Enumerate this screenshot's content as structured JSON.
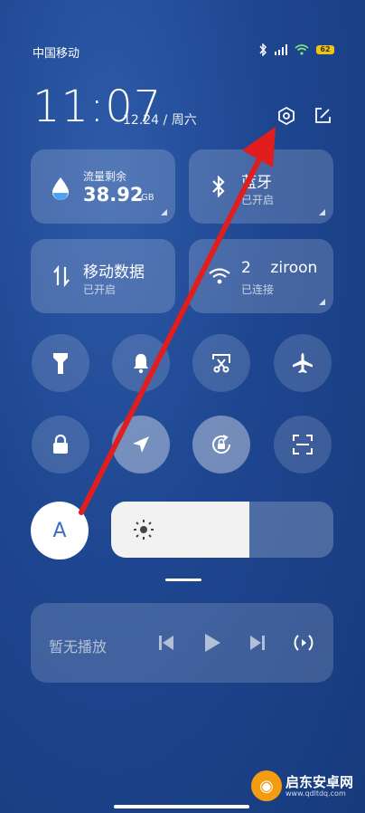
{
  "status": {
    "carrier": "中国移动",
    "battery": "62"
  },
  "header": {
    "time": "11:07",
    "date": "12.24 / 周六"
  },
  "tiles": {
    "data_left": {
      "title": "流量剩余",
      "value": "38.92",
      "unit": "GB"
    },
    "bluetooth": {
      "title": "蓝牙",
      "sub": "已开启"
    },
    "mobile_data": {
      "title": "移动数据",
      "sub": "已开启"
    },
    "wifi": {
      "title": "2    ziroon",
      "sub": "已连接"
    }
  },
  "toggles": [
    {
      "name": "flashlight-icon",
      "on": false
    },
    {
      "name": "bell-icon",
      "on": false
    },
    {
      "name": "screenshot-icon",
      "on": false
    },
    {
      "name": "airplane-icon",
      "on": false
    },
    {
      "name": "lock-icon",
      "on": false
    },
    {
      "name": "location-icon",
      "on": true
    },
    {
      "name": "rotation-lock-icon",
      "on": true
    },
    {
      "name": "scan-icon",
      "on": false
    }
  ],
  "font_button": {
    "label": "A"
  },
  "brightness": {
    "level": 0.62
  },
  "media": {
    "text": "暂无播放"
  },
  "watermark": {
    "name": "启东安卓网",
    "url": "www.qdltdq.com"
  },
  "colors": {
    "accent": "#3b6cc9",
    "arrow": "#e11d1d",
    "battery": "#f1c40f"
  }
}
